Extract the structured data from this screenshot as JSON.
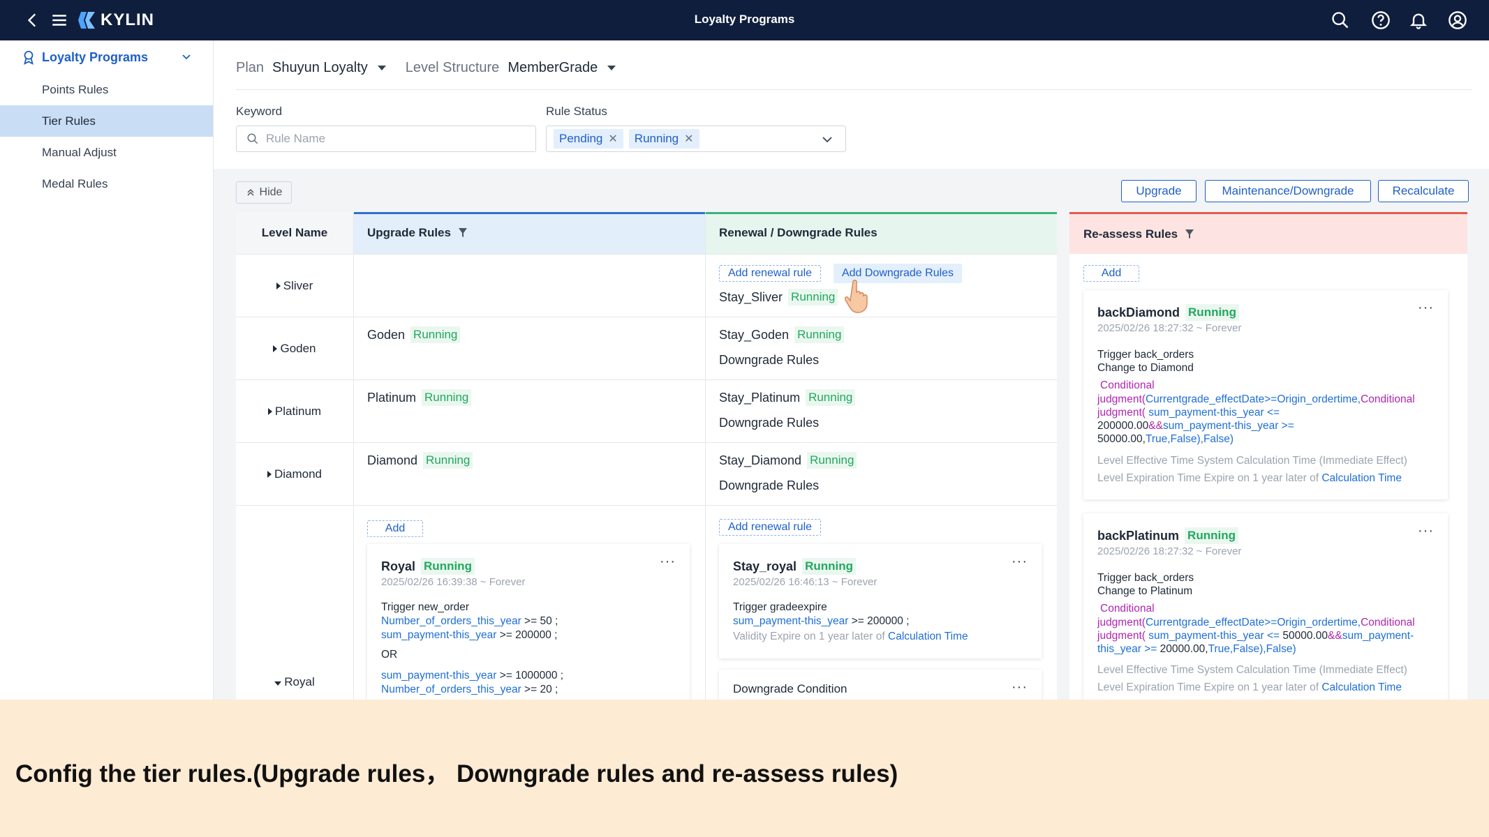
{
  "topbar": {
    "brand": "KYLIN",
    "title": "Loyalty Programs",
    "icons": [
      "back-icon",
      "menu-icon",
      "search-icon",
      "help-icon",
      "bell-icon",
      "user-icon"
    ]
  },
  "sidebar": {
    "header": "Loyalty Programs",
    "items": [
      {
        "label": "Points Rules"
      },
      {
        "label": "Tier Rules"
      },
      {
        "label": "Manual Adjust"
      },
      {
        "label": "Medal Rules"
      }
    ]
  },
  "filters": {
    "plan_label": "Plan",
    "plan_value": "Shuyun Loyalty",
    "level_label": "Level Structure",
    "level_value": "MemberGrade",
    "keyword_label": "Keyword",
    "keyword_placeholder": "Rule Name",
    "status_label": "Rule Status",
    "status_tags": [
      "Pending",
      "Running"
    ]
  },
  "toolbar": {
    "hide": "Hide",
    "upgrade": "Upgrade",
    "maintenance": "Maintenance/Downgrade",
    "recalculate": "Recalculate"
  },
  "grid": {
    "headers": {
      "level": "Level Name",
      "upgrade": "Upgrade Rules",
      "renewal": "Renewal / Downgrade Rules",
      "reassess": "Re-assess Rules"
    },
    "status_running": "Running",
    "add": "Add",
    "add_renewal": "Add renewal rule",
    "add_downgrade": "Add Downgrade Rules",
    "downgrade_rules": "Downgrade Rules",
    "rows": [
      {
        "level": "Sliver",
        "upgrade": "",
        "renewal": "Stay_Sliver"
      },
      {
        "level": "Goden",
        "upgrade": "Goden",
        "renewal": "Stay_Goden"
      },
      {
        "level": "Platinum",
        "upgrade": "Platinum",
        "renewal": "Stay_Platinum"
      },
      {
        "level": "Diamond",
        "upgrade": "Diamond",
        "renewal": "Stay_Diamond"
      },
      {
        "level": "Royal"
      }
    ],
    "royal_card": {
      "title": "Royal",
      "date": "2025/02/26 16:39:38 ~ Forever",
      "trigger": "Trigger new_order",
      "l1_field": "Number_of_orders_this_year",
      "l1_cond": " >= 50 ;",
      "l2_field": "sum_payment-this_year",
      "l2_cond": " >= 200000 ;",
      "or": "OR",
      "l3_field": "sum_payment-this_year",
      "l3_cond": " >= 1000000 ;",
      "l4_field": "Number_of_orders_this_year",
      "l4_cond": " >= 20 ;"
    },
    "stay_royal_card": {
      "title": "Stay_royal",
      "date": "2025/02/26 16:46:13 ~ Forever",
      "trigger": "Trigger gradeexpire",
      "l1_field": "sum_payment-this_year",
      "l1_cond": " >= 200000 ;",
      "validity": "Validity Expire on 1 year later of ",
      "calc": "Calculation Time"
    },
    "downgrade_card": {
      "title": "Downgrade Condition"
    }
  },
  "reassess": {
    "cards": [
      {
        "title": "backDiamond",
        "date": "2025/02/26 18:27:32 ~ Forever",
        "trigger": "Trigger back_orders",
        "change": "Change to Diamond",
        "c1": "Conditional",
        "c2a": "judgment(",
        "c2b": "Currentgrade_effectDate>=Origin_ordertime,",
        "c2c": "Conditional",
        "c3a": "judgment(",
        "c3b": " sum_payment-this_year <=",
        "c4a": "200000.00",
        "c4b": "&&",
        "c4c": "sum_payment-this_year >=",
        "c5a": "50000.00,",
        "c5b": "True,",
        "c5c": "False),",
        "c5d": "False)",
        "eff": "Level Effective Time System Calculation Time (Immediate Effect)",
        "exp": "Level Expiration Time Expire on 1 year later of ",
        "calc": "Calculation Time"
      },
      {
        "title": "backPlatinum",
        "date": "2025/02/26 18:27:32 ~ Forever",
        "trigger": "Trigger back_orders",
        "change": "Change to Platinum",
        "c1": "Conditional",
        "c2a": "judgment(",
        "c2b": "Currentgrade_effectDate>=Origin_ordertime,",
        "c2c": "Conditional",
        "c3a": "judgment(",
        "c3b": " sum_payment-this_year <= ",
        "c3c": "50000.00",
        "c3d": "&&",
        "c3e": "sum_payment-",
        "c4a": "this_year >= ",
        "c4b": "20000.00,",
        "c4c": "True,",
        "c4d": "False),",
        "c4e": "False)",
        "eff": "Level Effective Time System Calculation Time (Immediate Effect)",
        "exp": "Level Expiration Time Expire on 1 year later of ",
        "calc": "Calculation Time"
      }
    ]
  },
  "banner": {
    "text": "Config the tier rules.(Upgrade rules，  Downgrade rules and re-assess rules)"
  },
  "colors": {
    "topbar": "#0f1e3d",
    "accent": "#1e5fc8",
    "running": "#22a860",
    "banner": "#fdebd3",
    "reassess_header": "#fde4e2"
  }
}
